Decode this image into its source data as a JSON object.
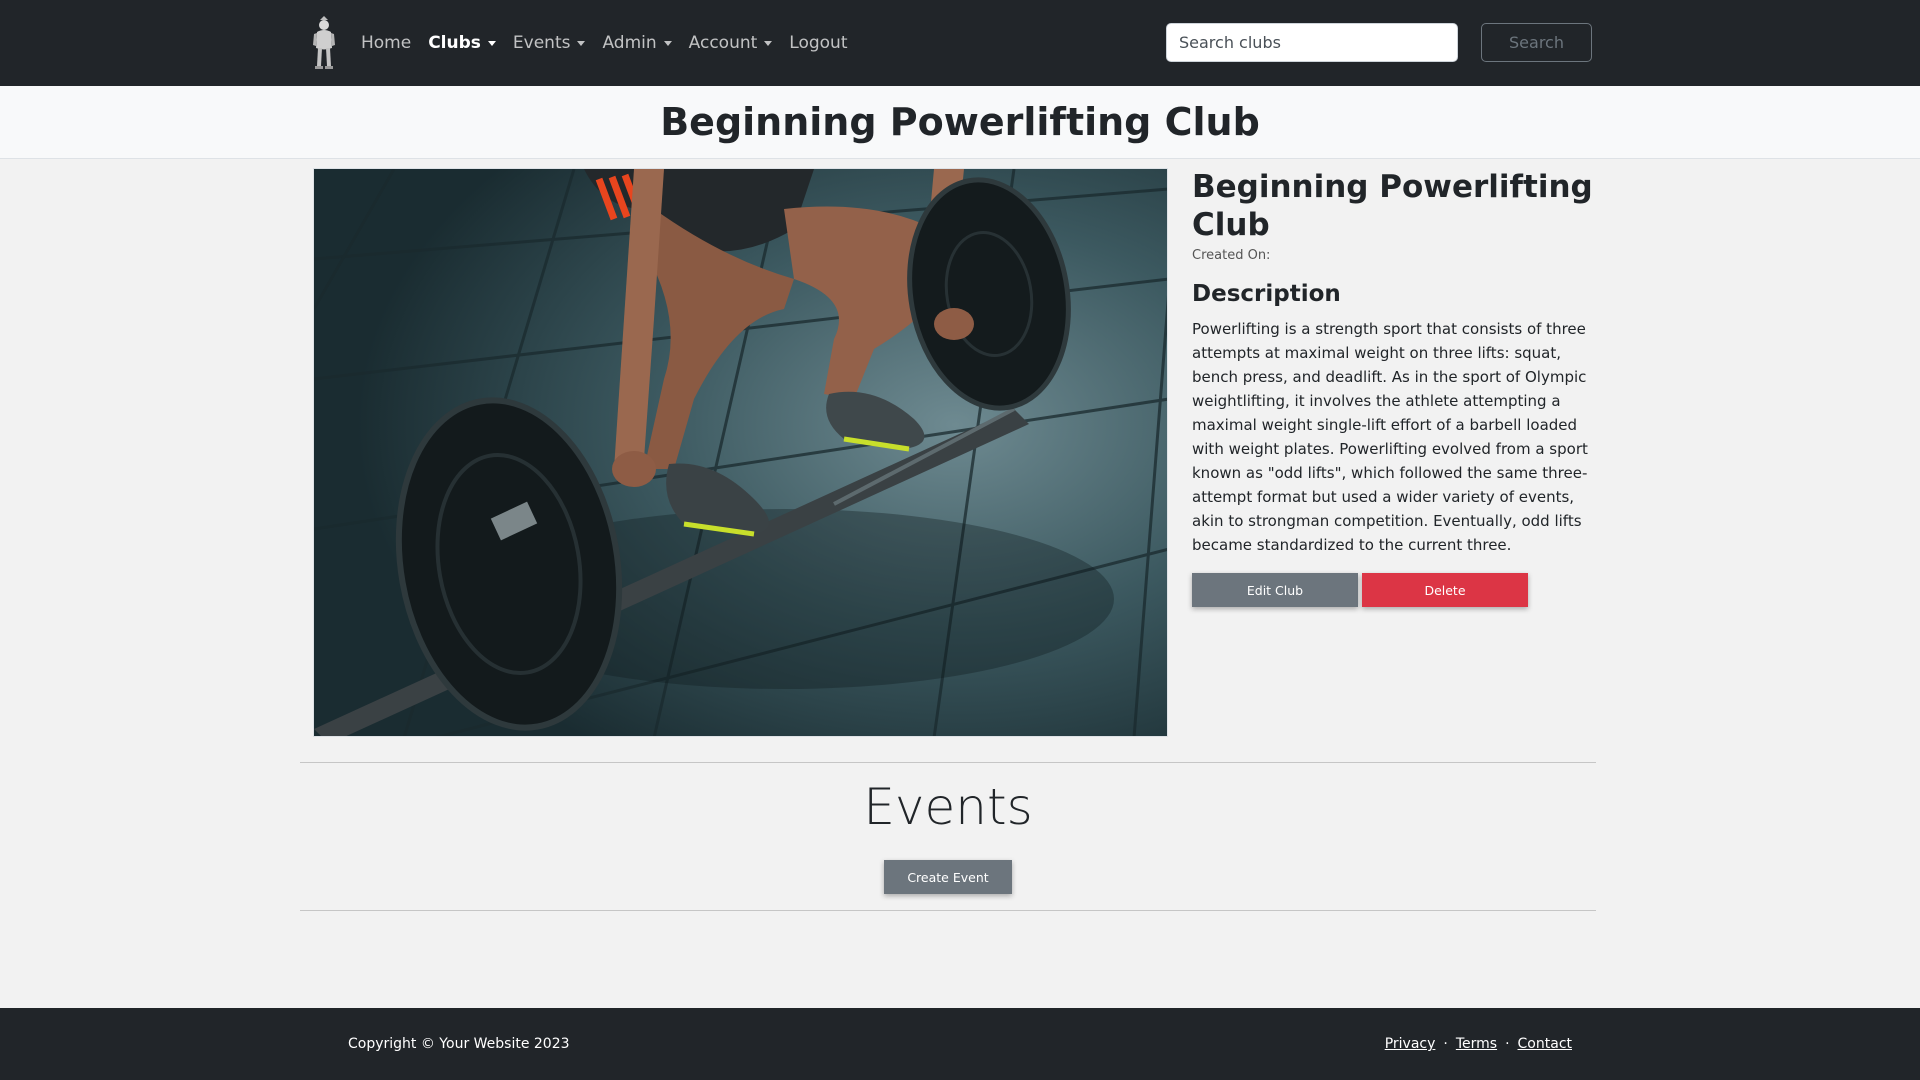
{
  "navbar": {
    "brand_logo": "mascot-logo-icon",
    "links": [
      {
        "label": "Home",
        "dropdown": false
      },
      {
        "label": "Clubs",
        "dropdown": true,
        "active": true
      },
      {
        "label": "Events",
        "dropdown": true
      },
      {
        "label": "Admin",
        "dropdown": true
      },
      {
        "label": "Account",
        "dropdown": true
      },
      {
        "label": "Logout",
        "dropdown": false
      }
    ],
    "search_placeholder": "Search clubs",
    "search_button": "Search"
  },
  "page_title": "Beginning Powerlifting Club",
  "club": {
    "image_icon": "barbell-deadlift-photo",
    "name": "Beginning Powerlifting Club",
    "created_on": "Created On:",
    "description_heading": "Description",
    "description": "Powerlifting is a strength sport that consists of three attempts at maximal weight on three lifts: squat, bench press, and deadlift. As in the sport of Olympic weightlifting, it involves the athlete attempting a maximal weight single-lift effort of a barbell loaded with weight plates. Powerlifting evolved from a sport known as \"odd lifts\", which followed the same three-attempt format but used a wider variety of events, akin to strongman competition. Eventually, odd lifts became standardized to the current three.",
    "edit_button": "Edit Club",
    "delete_button": "Delete"
  },
  "events": {
    "heading": "Events",
    "create_button": "Create Event"
  },
  "footer": {
    "copyright": "Copyright © Your Website 2023",
    "links": [
      "Privacy",
      "Terms",
      "Contact"
    ],
    "separator": "·"
  },
  "colors": {
    "navbar_bg": "#212529",
    "page_bg": "#f2f2f2",
    "secondary": "#6c757d",
    "danger": "#dc3545"
  }
}
